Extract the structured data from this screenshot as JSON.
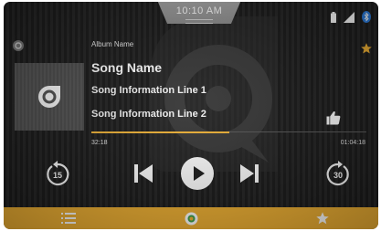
{
  "status_bar": {
    "time": "10:10 AM",
    "icons": [
      "battery-icon",
      "signal-icon",
      "bluetooth-icon"
    ]
  },
  "now_playing": {
    "album": "Album Name",
    "song": "Song Name",
    "info_line_1": "Song Information Line 1",
    "info_line_2": "Song Information Line 2",
    "favorited": true,
    "liked": true
  },
  "progress": {
    "elapsed": "32:18",
    "total": "01:04:18",
    "fraction": 0.5
  },
  "controls": {
    "rewind_seconds": "15",
    "forward_seconds": "30",
    "state": "paused"
  },
  "bottom_tabs": [
    {
      "icon": "list-icon"
    },
    {
      "icon": "app-logo-icon"
    },
    {
      "icon": "star-icon"
    }
  ],
  "colors": {
    "accent": "#f0b133",
    "background": "#1e1e1e",
    "text": "#ffffff",
    "bluetooth": "#2a7de1"
  }
}
